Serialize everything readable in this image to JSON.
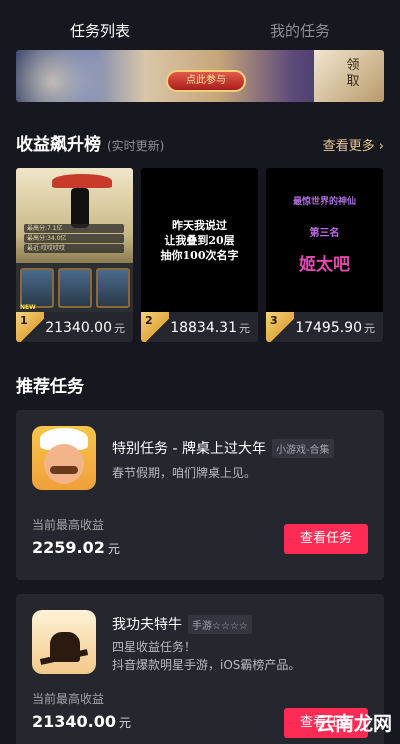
{
  "tabs": [
    {
      "label": "任务列表",
      "active": true
    },
    {
      "label": "我的任务",
      "active": false
    }
  ],
  "banner": {
    "button_label": "点此参与",
    "side_text": "领取"
  },
  "ranking": {
    "title": "收益飙升榜",
    "subtitle": "(实时更新)",
    "more_label": "查看更多 ›",
    "items": [
      {
        "rank": "1",
        "amount": "21340.00",
        "unit": "元",
        "stats": [
          "最高分:7.1亿",
          "最高分:34.0亿",
          "最近:哎哎哎哎"
        ],
        "badge": "NEW"
      },
      {
        "rank": "2",
        "amount": "18834.31",
        "unit": "元",
        "text": [
          "昨天我说过",
          "让我叠到20层",
          "抽你100次名字"
        ]
      },
      {
        "rank": "3",
        "amount": "17495.90",
        "unit": "元",
        "text": [
          "最惊世界的神仙",
          "第三名",
          "姬太吧"
        ]
      }
    ]
  },
  "recommend": {
    "title": "推荐任务",
    "tasks": [
      {
        "icon": "chef-game-icon",
        "name": "特别任务 - 牌桌上过大年",
        "tag": "小游戏-合集",
        "desc": [
          "春节假期，咱们牌桌上见。"
        ],
        "earn_label": "当前最高收益",
        "earn_value": "2259.02",
        "earn_unit": "元",
        "button": "查看任务"
      },
      {
        "icon": "kungfu-game-icon",
        "name": "我功夫特牛",
        "tag": "手游☆☆☆☆",
        "desc": [
          "四星收益任务！",
          "抖音爆款明星手游，iOS霸榜产品。"
        ],
        "earn_label": "当前最高收益",
        "earn_value": "21340.00",
        "earn_unit": "元",
        "button": "查看任务"
      }
    ]
  },
  "watermark": "云南龙网",
  "colors": {
    "background": "#17181f",
    "card": "#25262e",
    "accent": "#fe2c55",
    "gold": "#e8c690"
  }
}
